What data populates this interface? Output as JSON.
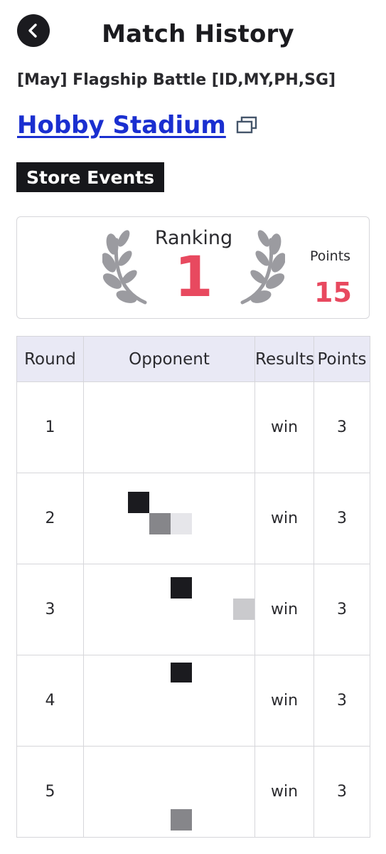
{
  "header": {
    "title": "Match History",
    "back_icon": "chevron-left-icon"
  },
  "event": {
    "name": "[May] Flagship Battle [ID,MY,PH,SG]",
    "store_name": "Hobby Stadium",
    "store_link_icon": "external-window-icon",
    "category_badge": "Store Events"
  },
  "ranking": {
    "label": "Ranking",
    "value": "1",
    "points_label": "Points",
    "points_value": "15",
    "accent_color": "#e8495f",
    "laurel_color": "#9b9ba0"
  },
  "table": {
    "headers": [
      "Round",
      "Opponent",
      "Results",
      "Points"
    ],
    "rows": [
      {
        "round": "1",
        "opponent": "",
        "result": "win",
        "points": "3"
      },
      {
        "round": "2",
        "opponent": "",
        "result": "win",
        "points": "3"
      },
      {
        "round": "3",
        "opponent": "",
        "result": "win",
        "points": "3"
      },
      {
        "round": "4",
        "opponent": "",
        "result": "win",
        "points": "3"
      },
      {
        "round": "5",
        "opponent": "",
        "result": "win",
        "points": "3"
      }
    ]
  },
  "colors": {
    "link": "#1a2fd0",
    "badge_bg": "#16171b",
    "table_header_bg": "#e9e9f5"
  }
}
